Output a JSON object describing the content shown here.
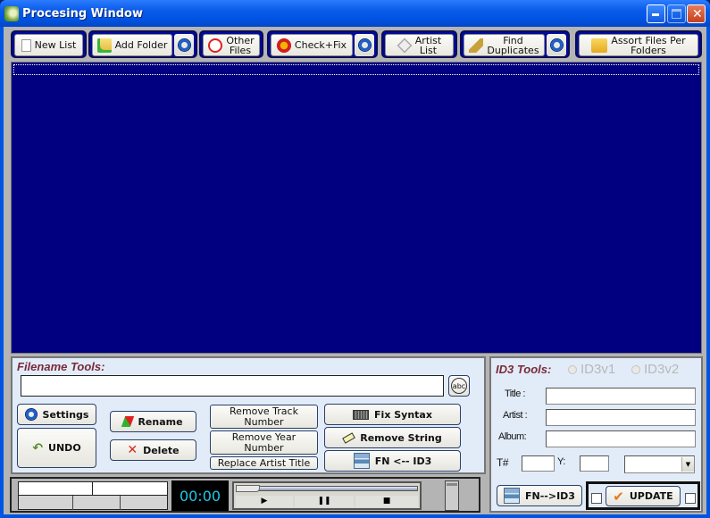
{
  "window": {
    "title": "Procesing Window",
    "controls": {
      "minimize": "_",
      "maximize": "□",
      "close": "✕"
    }
  },
  "toolbar": {
    "new_list": "New List",
    "add_folder": "Add Folder",
    "other_files": [
      "Other",
      "Files"
    ],
    "check_fix": "Check+Fix",
    "artist_list": [
      "Artist",
      "List"
    ],
    "find_duplicates": [
      "Find",
      "Duplicates"
    ],
    "assort_files": [
      "Assort Files Per",
      "Folders"
    ]
  },
  "filename_tools": {
    "header": "Filename Tools:",
    "input_value": "",
    "spellcheck_label": "abc",
    "settings": "Settings",
    "undo": "UNDO",
    "rename": "Rename",
    "delete": "Delete",
    "remove_track": [
      "Remove Track",
      "Number"
    ],
    "remove_year": [
      "Remove Year",
      "Number"
    ],
    "replace_artist_title": "Replace Artist Title",
    "fix_syntax": "Fix Syntax",
    "remove_string": "Remove String",
    "fn_from_id3": "FN <-- ID3"
  },
  "id3_tools": {
    "header": "ID3 Tools:",
    "radio_v1": "ID3v1",
    "radio_v2": "ID3v2",
    "title_label": "Title :",
    "artist_label": "Artist :",
    "album_label": "Album:",
    "track_label": "T#",
    "year_label": "Y:",
    "title_value": "",
    "artist_value": "",
    "album_value": "",
    "track_value": "",
    "year_value": "",
    "genre_value": "",
    "fn_to_id3": "FN-->ID3",
    "update": "UPDATE"
  },
  "player": {
    "time": "00:00",
    "progress": 0.0
  }
}
